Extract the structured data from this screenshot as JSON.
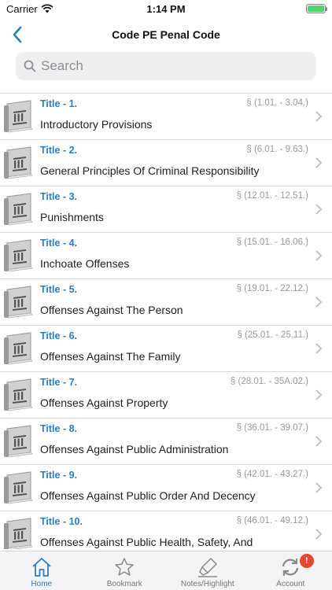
{
  "status_bar": {
    "carrier": "Carrier",
    "time": "1:14 PM"
  },
  "nav": {
    "title": "Code PE Penal Code"
  },
  "search": {
    "placeholder": "Search"
  },
  "titles": [
    {
      "title": "Title - 1.",
      "range": "§ (1.01. - 3.04.)",
      "label": "Introductory Provisions"
    },
    {
      "title": "Title - 2.",
      "range": "§ (6.01. - 9.63.)",
      "label": "General Principles Of Criminal Responsibility"
    },
    {
      "title": "Title - 3.",
      "range": "§ (12.01. - 12.51.)",
      "label": "Punishments"
    },
    {
      "title": "Title - 4.",
      "range": "§ (15.01. - 16.06.)",
      "label": "Inchoate Offenses"
    },
    {
      "title": "Title - 5.",
      "range": "§ (19.01. - 22.12.)",
      "label": "Offenses Against The Person"
    },
    {
      "title": "Title - 6.",
      "range": "§ (25.01. - 25.11.)",
      "label": "Offenses Against The Family"
    },
    {
      "title": "Title - 7.",
      "range": "§ (28.01. - 35A.02.)",
      "label": "Offenses Against Property"
    },
    {
      "title": "Title - 8.",
      "range": "§ (36.01. - 39.07.)",
      "label": "Offenses Against Public Administration"
    },
    {
      "title": "Title - 9.",
      "range": "§ (42.01. - 43.27.)",
      "label": "Offenses Against Public Order And Decency"
    },
    {
      "title": "Title - 10.",
      "range": "§ (46.01. - 49.12.)",
      "label": "Offenses Against Public Health, Safety, And Morals"
    }
  ],
  "tabs": [
    {
      "label": "Home",
      "icon": "home-icon"
    },
    {
      "label": "Bookmark",
      "icon": "star-icon"
    },
    {
      "label": "Notes/Highlight",
      "icon": "highlighter-icon"
    },
    {
      "label": "Account",
      "icon": "sync-icon",
      "badge": "!"
    }
  ],
  "colors": {
    "accent": "#2b7ec2",
    "badge": "#e8452d",
    "battery": "#4cd964"
  }
}
